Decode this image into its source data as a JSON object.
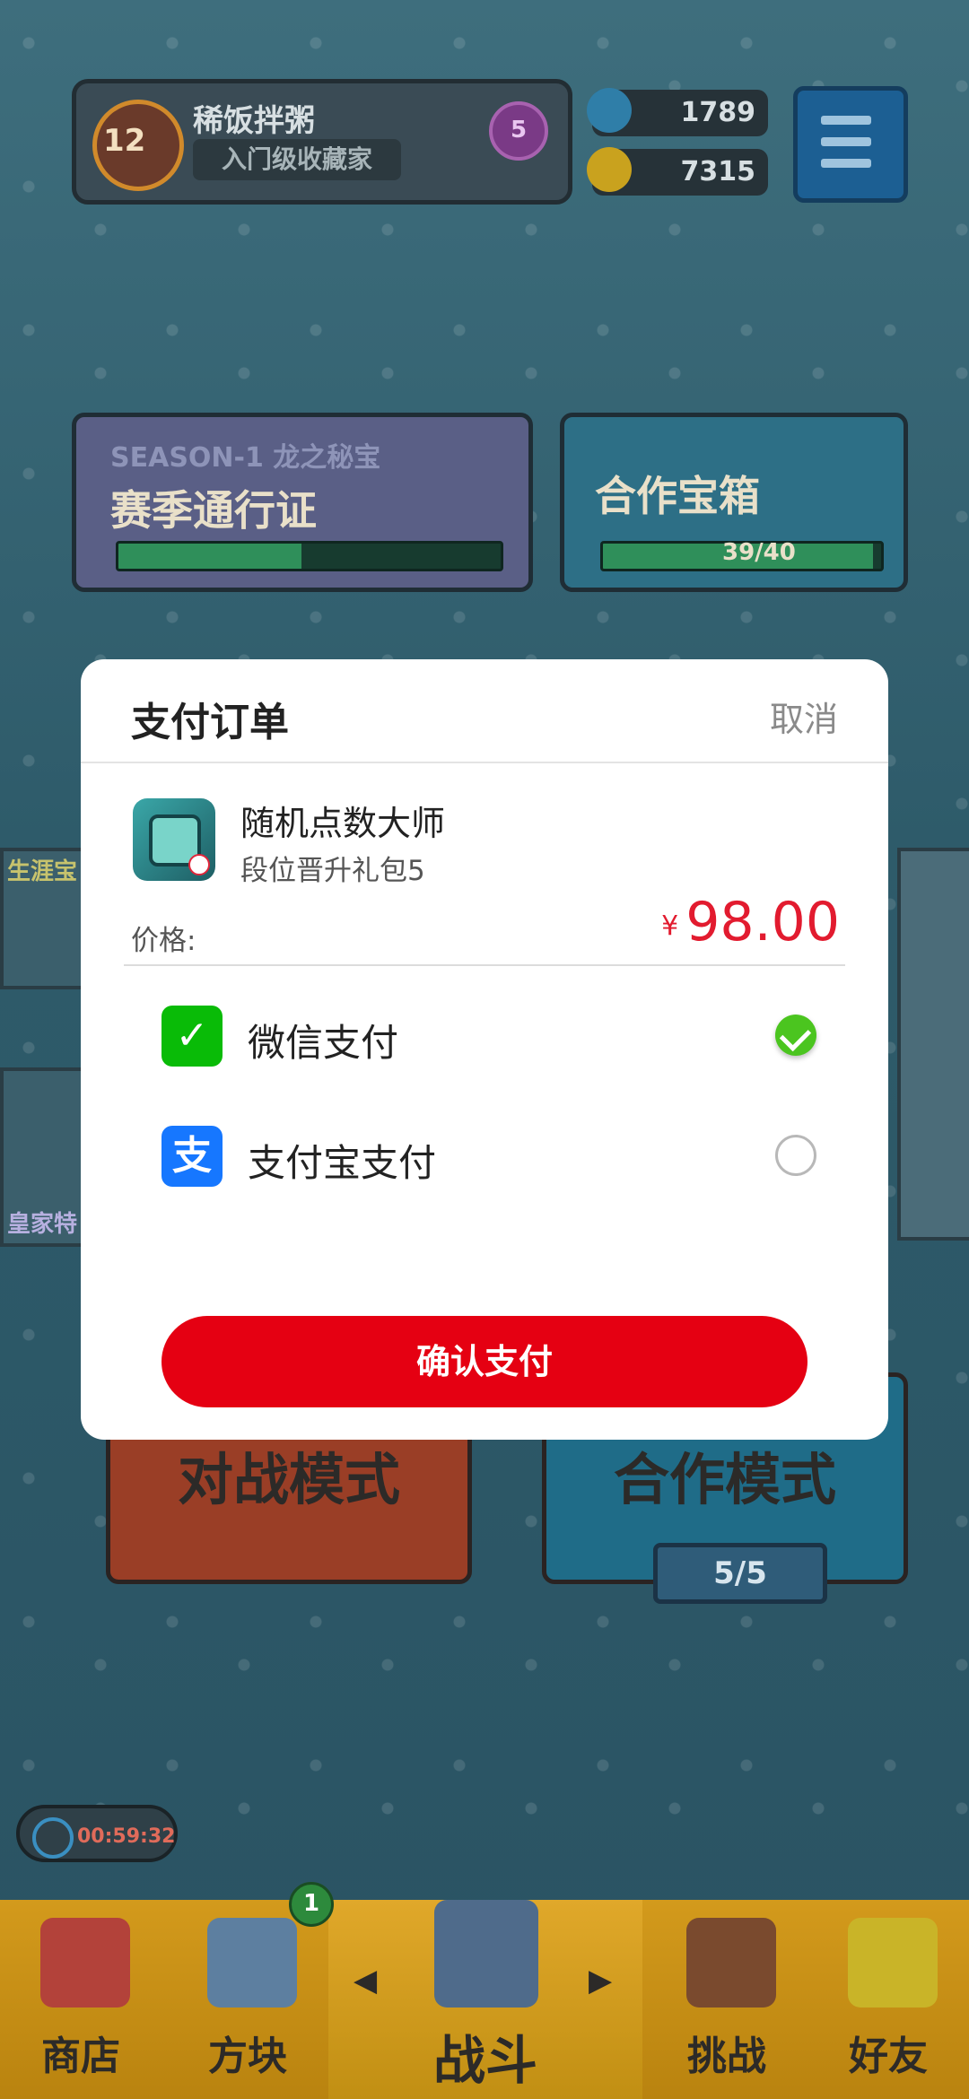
{
  "game": {
    "player_name": "稀饭拌粥",
    "player_level": "12",
    "player_title": "入门级收藏家",
    "medal_value": "5",
    "gems": "1789",
    "coins": "7315",
    "season_label": "SEASON-1 龙之秘宝",
    "season_pass": "赛季通行证",
    "coop_chest": "合作宝箱",
    "coop_progress": "39/40",
    "battle_mode": "对战模式",
    "coop_mode": "合作模式",
    "coop_mode_count": "5/5",
    "timer": "00:59:32",
    "side_label_top": "生涯宝",
    "side_label_bottom": "皇家特",
    "tabs": {
      "shop": "商店",
      "blocks": "方块",
      "battle": "战斗",
      "challenge": "挑战",
      "friends": "好友"
    },
    "blocks_badge": "1"
  },
  "dialog": {
    "title": "支付订单",
    "cancel": "取消",
    "product_name": "随机点数大师",
    "product_item": "段位晋升礼包5",
    "price_label": "价格:",
    "currency_symbol": "¥",
    "price": "98.00",
    "methods": [
      {
        "label": "微信支付",
        "selected": true
      },
      {
        "label": "支付宝支付",
        "selected": false
      }
    ],
    "confirm": "确认支付"
  },
  "colors": {
    "confirm": "#e50012",
    "price": "#e21b2f",
    "wechat": "#09bb07",
    "alipay": "#1677ff"
  }
}
